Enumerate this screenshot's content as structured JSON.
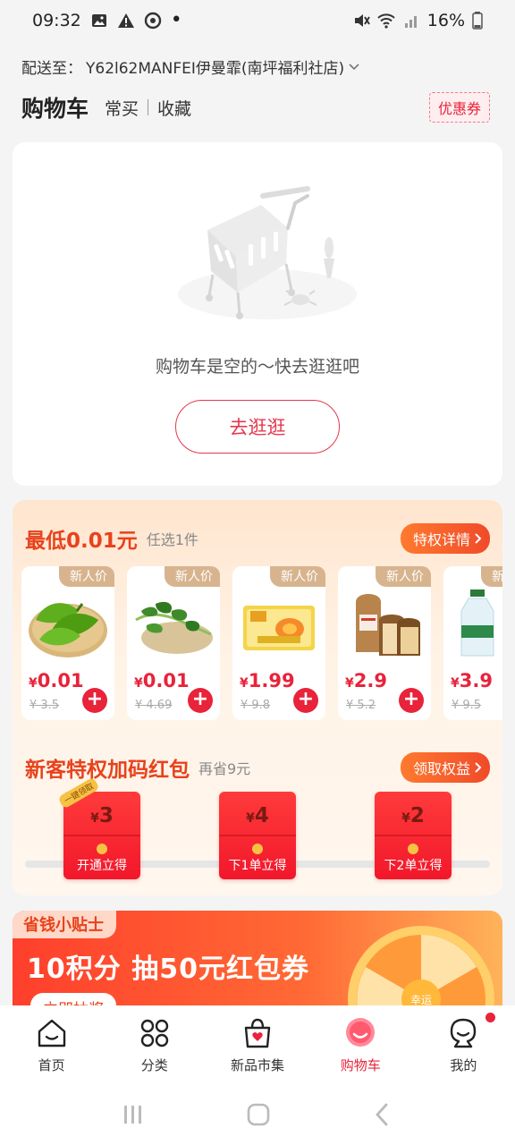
{
  "status": {
    "time": "09:32",
    "battery": "16%"
  },
  "address": {
    "prefix": "配送至：",
    "value": "Y62l62MANFEI伊曼霏(南坪福利社店)"
  },
  "header": {
    "title": "购物车",
    "tab_frequent": "常买",
    "tab_favorites": "收藏",
    "coupon": "优惠券"
  },
  "empty": {
    "message": "购物车是空的～快去逛逛吧",
    "button": "去逛逛"
  },
  "promo": {
    "title": "最低0.01元",
    "subtitle": "任选1件",
    "detail_button": "特权详情",
    "products": [
      {
        "tag": "新人价",
        "currency": "¥",
        "price": "0.01",
        "original": "¥ 3.5",
        "image": "green-pepper"
      },
      {
        "tag": "新人价",
        "currency": "¥",
        "price": "0.01",
        "original": "¥ 4.69",
        "image": "water-spinach"
      },
      {
        "tag": "新人价",
        "currency": "¥",
        "price": "1.99",
        "original": "¥ 9.8",
        "image": "egg-tofu"
      },
      {
        "tag": "新人价",
        "currency": "¥",
        "price": "2.9",
        "original": "¥ 5.2",
        "image": "toast-bread"
      },
      {
        "tag": "新人价",
        "currency": "¥",
        "price": "3.9",
        "original": "¥ 9.5",
        "image": "water-bottle"
      }
    ]
  },
  "redpacket": {
    "title": "新客特权加码红包",
    "subtitle": "再省9元",
    "button": "领取权益",
    "badge": "一键领取",
    "envelopes": [
      {
        "currency": "¥",
        "amount": "3",
        "label": "开通立得"
      },
      {
        "currency": "¥",
        "amount": "4",
        "label": "下1单立得"
      },
      {
        "currency": "¥",
        "amount": "2",
        "label": "下2单立得"
      }
    ]
  },
  "banner": {
    "tag": "省钱小贴士",
    "title": "10积分 抽50元红包券",
    "button": "立即抽奖",
    "wheel_text": "幸运"
  },
  "tabbar": {
    "items": [
      {
        "label": "首页",
        "icon": "home-icon"
      },
      {
        "label": "分类",
        "icon": "category-icon"
      },
      {
        "label": "新品市集",
        "icon": "bag-icon"
      },
      {
        "label": "购物车",
        "icon": "cart-icon"
      },
      {
        "label": "我的",
        "icon": "profile-icon"
      }
    ]
  },
  "colors": {
    "accent": "#e8233a",
    "promo_title": "#e8421c",
    "tag": "#d7b48e"
  }
}
